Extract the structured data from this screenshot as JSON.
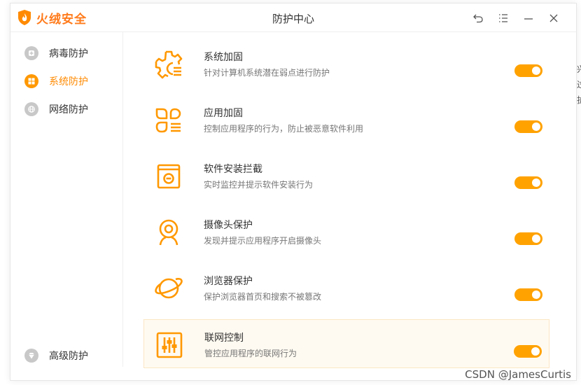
{
  "app": {
    "brand_name": "火绒安全",
    "window_title": "防护中心",
    "accent_color": "#ff9800",
    "controls": [
      {
        "name": "back-icon"
      },
      {
        "name": "menu-icon"
      },
      {
        "name": "minimize-icon"
      },
      {
        "name": "close-icon"
      }
    ]
  },
  "sidebar": {
    "items": [
      {
        "label": "病毒防护",
        "icon": "plus-shield-icon",
        "active": false
      },
      {
        "label": "系统防护",
        "icon": "windows-icon",
        "active": true
      },
      {
        "label": "网络防护",
        "icon": "globe-icon",
        "active": false
      }
    ],
    "bottom_item": {
      "label": "高级防护",
      "icon": "diamond-icon"
    }
  },
  "features": [
    {
      "title": "系统加固",
      "desc": "针对计算机系统潜在弱点进行防护",
      "icon": "gear-shield-icon",
      "enabled": true
    },
    {
      "title": "应用加固",
      "desc": "控制应用程序的行为，防止被恶意软件利用",
      "icon": "app-grid-icon",
      "enabled": true
    },
    {
      "title": "软件安装拦截",
      "desc": "实时监控并提示软件安装行为",
      "icon": "install-box-icon",
      "enabled": true
    },
    {
      "title": "摄像头保护",
      "desc": "发现并提示应用程序开启摄像头",
      "icon": "webcam-icon",
      "enabled": true
    },
    {
      "title": "浏览器保护",
      "desc": "保护浏览器首页和搜索不被篡改",
      "icon": "planet-icon",
      "enabled": true
    },
    {
      "title": "联网控制",
      "desc": "管控应用程序的联网行为",
      "icon": "sliders-icon",
      "enabled": true
    }
  ],
  "watermark": "CSDN @JamesCurtis",
  "edge_text": [
    "兴",
    "过",
    "护"
  ]
}
